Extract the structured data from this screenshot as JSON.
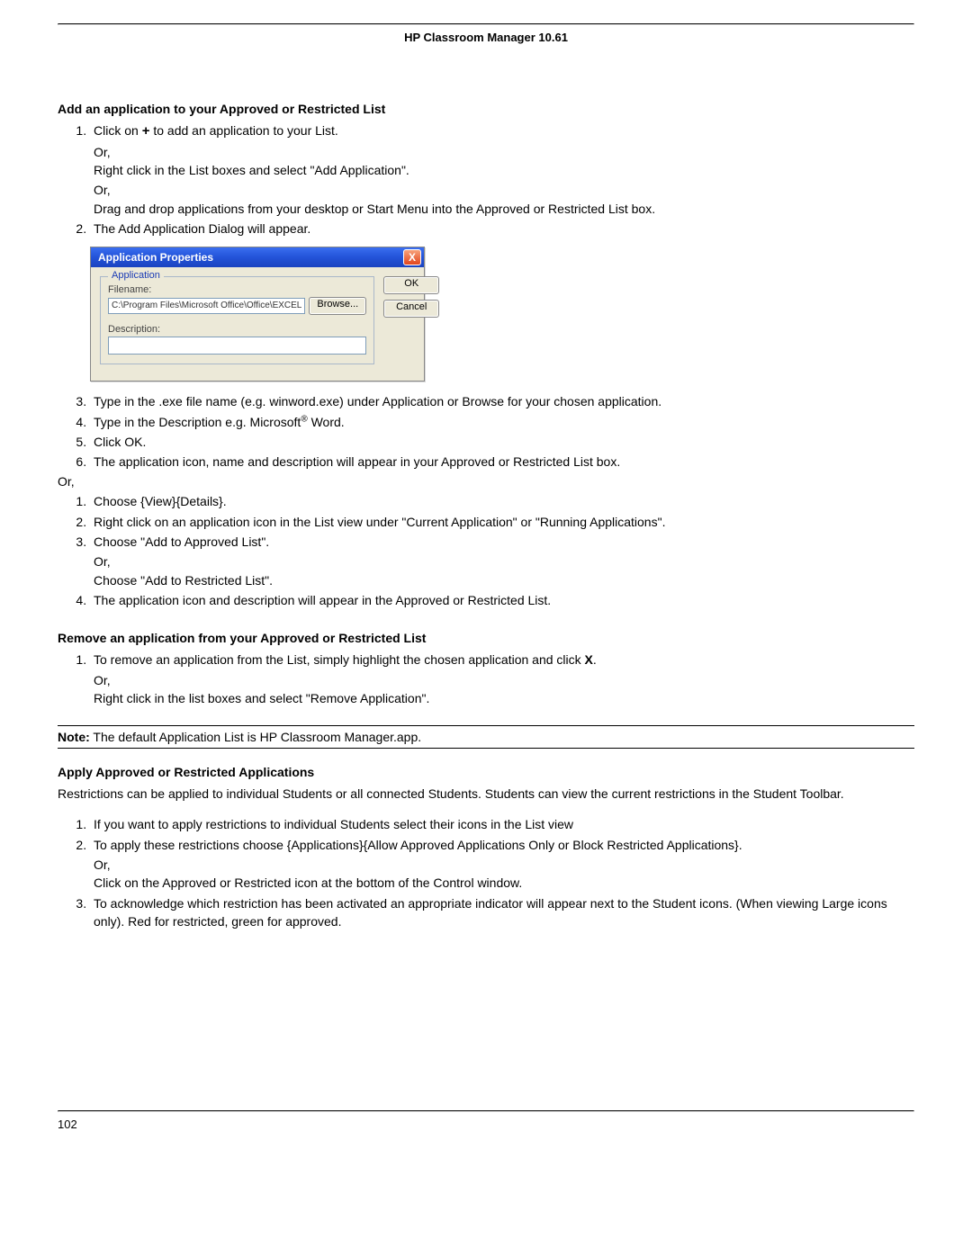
{
  "header": {
    "title": "HP Classroom Manager 10.61"
  },
  "sec1": {
    "heading": "Add an application to your Approved or Restricted List",
    "steps_a": [
      {
        "main_pre": "Click on ",
        "main_post": " to add an application to your List.",
        "or1": "Or,",
        "sub1": "Right click in the List boxes and select \"Add Application\".",
        "or2": "Or,",
        "sub2": "Drag and drop applications from your desktop or Start Menu into the Approved or Restricted List box."
      },
      {
        "main": "The Add Application Dialog will appear."
      }
    ],
    "steps_b": [
      {
        "main": "Type in the .exe file name (e.g. winword.exe) under Application or Browse for your chosen application."
      },
      {
        "main_pre": "Type in the Description e.g. Microsoft",
        "sup": "®",
        "main_post": " Word."
      },
      {
        "main": "Click OK."
      },
      {
        "main": "The application icon, name and description will appear in your Approved or Restricted List box."
      }
    ],
    "or_outside": "Or,",
    "steps_c": [
      {
        "main": "Choose {View}{Details}."
      },
      {
        "main": "Right click on an application icon in the List view under \"Current Application\" or \"Running Applications\"."
      },
      {
        "main": "Choose \"Add to Approved List\".",
        "or1": "Or,",
        "sub1": "Choose \"Add to Restricted List\"."
      },
      {
        "main": "The application icon and description will appear in the Approved or Restricted List."
      }
    ]
  },
  "dialog": {
    "title": "Application Properties",
    "group": "Application",
    "filename_label": "Filename:",
    "filename_value": "C:\\Program Files\\Microsoft Office\\Office\\EXCEL",
    "browse": "Browse...",
    "description_label": "Description:",
    "ok": "OK",
    "cancel": "Cancel",
    "close_x": "X"
  },
  "sec2": {
    "heading": "Remove an application from your Approved or Restricted List",
    "steps": [
      {
        "main_pre": "To remove an application from the List, simply highlight the chosen application and click ",
        "main_post": ".",
        "or1": "Or,",
        "sub1": "Right click in the list boxes and select \"Remove Application\"."
      }
    ]
  },
  "note": {
    "label": "Note:",
    "text": " The default Application List is HP Classroom Manager.app."
  },
  "sec3": {
    "heading": "Apply Approved or Restricted Applications",
    "intro": "Restrictions can be applied to individual Students or all connected Students. Students can view the current restrictions in the Student Toolbar.",
    "steps": [
      {
        "main": "If you want to apply restrictions to individual Students select their icons in the List view"
      },
      {
        "main": "To apply these restrictions choose {Applications}{Allow Approved Applications Only or Block Restricted Applications}.",
        "or1": "Or,",
        "sub1": "Click on the Approved or Restricted icon at the bottom of the Control window."
      },
      {
        "main": "To acknowledge which restriction has been activated an appropriate indicator will appear next to the Student icons. (When viewing Large icons only). Red for restricted, green for approved."
      }
    ]
  },
  "footer": {
    "page": "102"
  }
}
